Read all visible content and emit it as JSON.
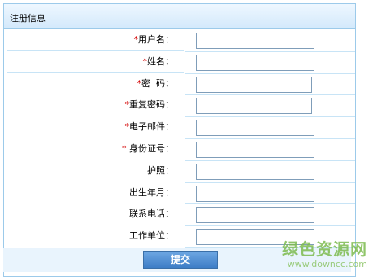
{
  "header": {
    "title": "注册信息"
  },
  "form": {
    "fields": [
      {
        "label": "用户名：",
        "required": true,
        "value": ""
      },
      {
        "label": "姓名：",
        "required": true,
        "value": ""
      },
      {
        "label": "密  码：",
        "required": true,
        "value": ""
      },
      {
        "label": "重复密码：",
        "required": true,
        "value": ""
      },
      {
        "label": "电子邮件：",
        "required": true,
        "value": ""
      },
      {
        "label": " 身份证号：",
        "required": true,
        "value": ""
      },
      {
        "label": "护照：",
        "required": false,
        "value": ""
      },
      {
        "label": "出生年月：",
        "required": false,
        "value": ""
      },
      {
        "label": "联系电话：",
        "required": false,
        "value": ""
      },
      {
        "label": "工作单位：",
        "required": false,
        "value": ""
      }
    ],
    "required_mark": "*",
    "submit_label": "提交"
  },
  "watermark": {
    "text": "绿色资源网",
    "url": "www.downcc.com"
  },
  "colors": {
    "border": "#9ccaea",
    "header_bg": "#d3e9fb",
    "required": "#d40000",
    "button_bg": "#3d7dc6"
  }
}
